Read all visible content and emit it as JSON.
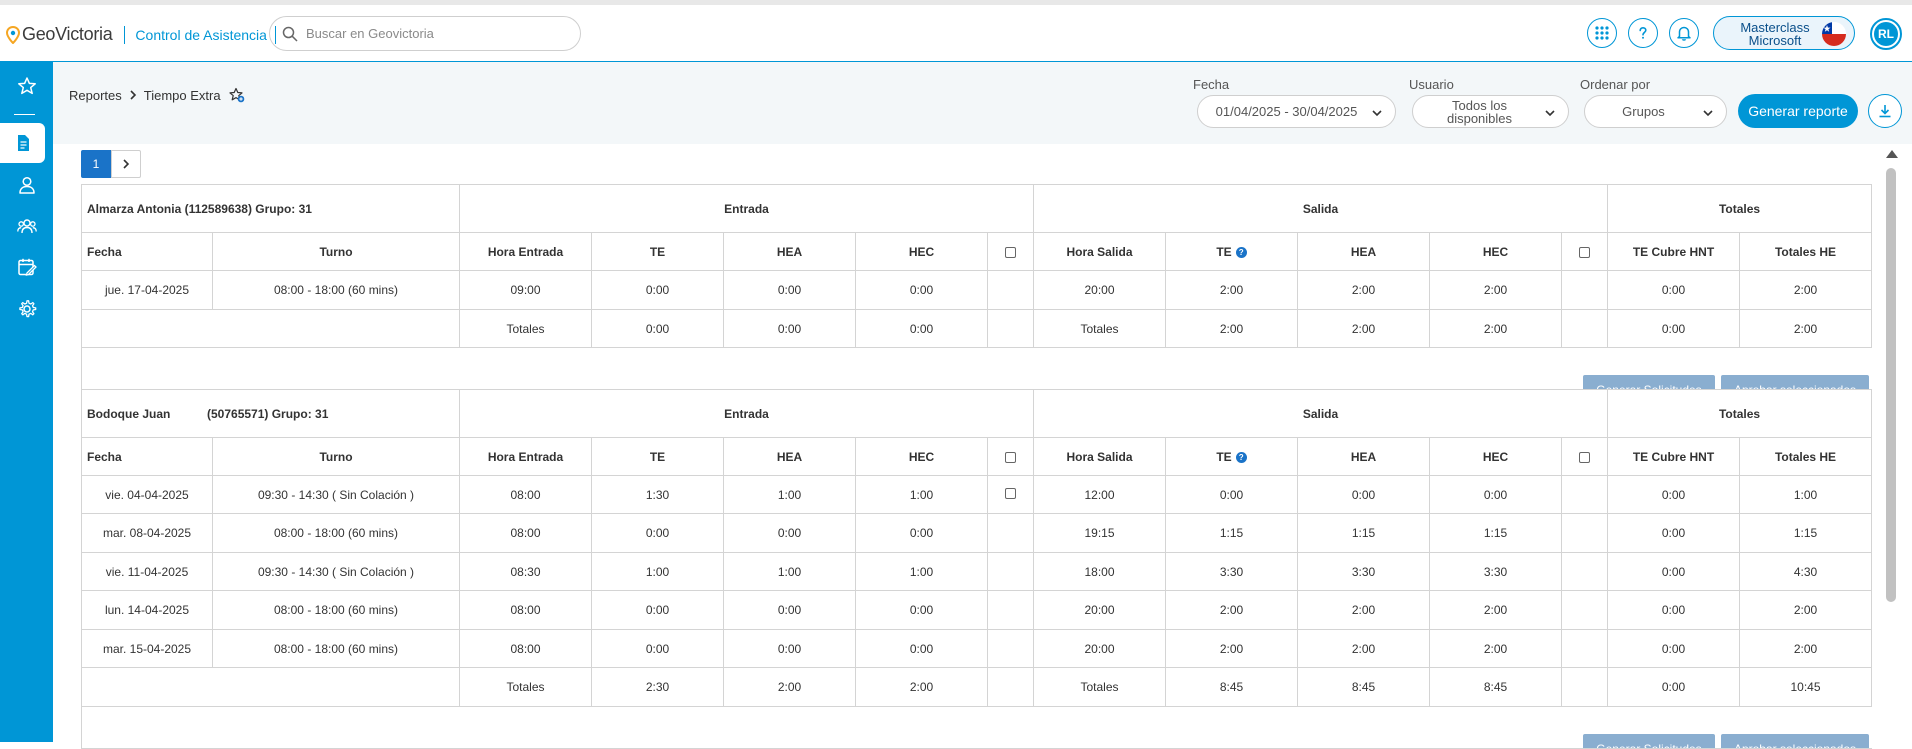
{
  "header": {
    "logo_text": "GeoVictoria",
    "module": "Control de Asistencia",
    "search_placeholder": "Buscar en Geovictoria",
    "company_line1": "Masterclass",
    "company_line2": "Microsoft",
    "avatar_initials": "RL",
    "accent": "#0096d6"
  },
  "breadcrumb": {
    "parent": "Reportes",
    "current": "Tiempo Extra"
  },
  "filters": {
    "fecha_label": "Fecha",
    "fecha_value": "01/04/2025 - 30/04/2025",
    "usuario_label": "Usuario",
    "usuario_value_line1": "Todos los",
    "usuario_value_line2": "disponibles",
    "ordenar_label": "Ordenar por",
    "ordenar_value": "Grupos",
    "generate_label": "Generar reporte"
  },
  "pager": {
    "current": "1"
  },
  "columns": {
    "entrada": "Entrada",
    "salida": "Salida",
    "totales": "Totales",
    "fecha": "Fecha",
    "turno": "Turno",
    "hora_entrada": "Hora Entrada",
    "te": "TE",
    "hea": "HEA",
    "hec": "HEC",
    "hora_salida": "Hora Salida",
    "te_cubre_hnt": "TE Cubre HNT",
    "totales_he": "Totales HE",
    "totales_row": "Totales"
  },
  "actions": {
    "generar": "Generar Solicitudes",
    "aprobar": "Aprobar seleccionados"
  },
  "employees": [
    {
      "title": "Almarza Antonia (112589638) Grupo: 31",
      "rows": [
        {
          "fecha": "jue. 17-04-2025",
          "turno": "08:00 - 18:00 (60 mins)",
          "hora_entrada": "09:00",
          "te_in": "0:00",
          "hea_in": "0:00",
          "hec_in": "0:00",
          "hora_salida": "20:00",
          "te_out": "2:00",
          "hea_out": "2:00",
          "hec_out": "2:00",
          "te_cubre": "0:00",
          "totales_he": "2:00"
        }
      ],
      "totals": {
        "te_in": "0:00",
        "hea_in": "0:00",
        "hec_in": "0:00",
        "te_out": "2:00",
        "hea_out": "2:00",
        "hec_out": "2:00",
        "te_cubre": "0:00",
        "totales_he": "2:00"
      }
    },
    {
      "title": "Bodoque Juan           (50765571) Grupo: 31",
      "rows": [
        {
          "fecha": "vie. 04-04-2025",
          "turno": "09:30 - 14:30 ( Sin Colación )",
          "hora_entrada": "08:00",
          "te_in": "1:30",
          "hea_in": "1:00",
          "hec_in": "1:00",
          "hora_salida": "12:00",
          "te_out": "0:00",
          "hea_out": "0:00",
          "hec_out": "0:00",
          "te_cubre": "0:00",
          "totales_he": "1:00"
        },
        {
          "fecha": "mar. 08-04-2025",
          "turno": "08:00 - 18:00 (60 mins)",
          "hora_entrada": "08:00",
          "te_in": "0:00",
          "hea_in": "0:00",
          "hec_in": "0:00",
          "hora_salida": "19:15",
          "te_out": "1:15",
          "hea_out": "1:15",
          "hec_out": "1:15",
          "te_cubre": "0:00",
          "totales_he": "1:15"
        },
        {
          "fecha": "vie. 11-04-2025",
          "turno": "09:30 - 14:30 ( Sin Colación )",
          "hora_entrada": "08:30",
          "te_in": "1:00",
          "hea_in": "1:00",
          "hec_in": "1:00",
          "hora_salida": "18:00",
          "te_out": "3:30",
          "hea_out": "3:30",
          "hec_out": "3:30",
          "te_cubre": "0:00",
          "totales_he": "4:30"
        },
        {
          "fecha": "lun. 14-04-2025",
          "turno": "08:00 - 18:00 (60 mins)",
          "hora_entrada": "08:00",
          "te_in": "0:00",
          "hea_in": "0:00",
          "hec_in": "0:00",
          "hora_salida": "20:00",
          "te_out": "2:00",
          "hea_out": "2:00",
          "hec_out": "2:00",
          "te_cubre": "0:00",
          "totales_he": "2:00"
        },
        {
          "fecha": "mar. 15-04-2025",
          "turno": "08:00 - 18:00 (60 mins)",
          "hora_entrada": "08:00",
          "te_in": "0:00",
          "hea_in": "0:00",
          "hec_in": "0:00",
          "hora_salida": "20:00",
          "te_out": "2:00",
          "hea_out": "2:00",
          "hec_out": "2:00",
          "te_cubre": "0:00",
          "totales_he": "2:00"
        }
      ],
      "totals": {
        "te_in": "2:30",
        "hea_in": "2:00",
        "hec_in": "2:00",
        "te_out": "8:45",
        "hea_out": "8:45",
        "hec_out": "8:45",
        "te_cubre": "0:00",
        "totales_he": "10:45"
      }
    }
  ]
}
